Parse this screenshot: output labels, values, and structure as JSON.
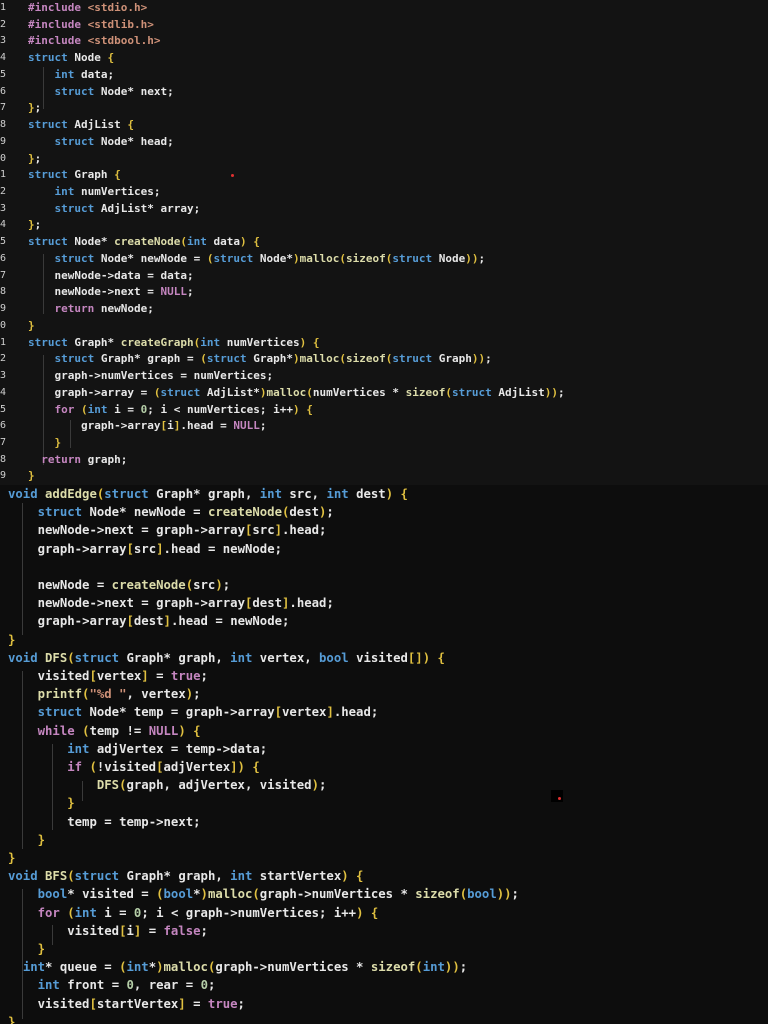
{
  "colors": {
    "keyword": "#569cd6",
    "control": "#c586c0",
    "function": "#dcdcaa",
    "text": "#e8e8e8",
    "punctuation": "#e0c040",
    "string": "#ce9178",
    "number": "#b5cea8"
  },
  "top_panel": {
    "line_numbers": [
      "1",
      "2",
      "3",
      "4",
      "5",
      "6",
      "7",
      "8",
      "9",
      "0",
      "1",
      "2",
      "3",
      "4",
      "5",
      "6",
      "7",
      "8",
      "9",
      "0",
      "1",
      "2",
      "3",
      "4",
      "5",
      "6",
      "7",
      "8",
      "9"
    ],
    "lines": [
      "#include <stdio.h>",
      "#include <stdlib.h>",
      "#include <stdbool.h>",
      "struct Node {",
      "    int data;",
      "    struct Node* next;",
      "};",
      "struct AdjList {",
      "    struct Node* head;",
      "};",
      "struct Graph {",
      "    int numVertices;",
      "    struct AdjList* array;",
      "};",
      "struct Node* createNode(int data) {",
      "    struct Node* newNode = (struct Node*)malloc(sizeof(struct Node));",
      "    newNode->data = data;",
      "    newNode->next = NULL;",
      "    return newNode;",
      "}",
      "struct Graph* createGraph(int numVertices) {",
      "    struct Graph* graph = (struct Graph*)malloc(sizeof(struct Graph));",
      "    graph->numVertices = numVertices;",
      "    graph->array = (struct AdjList*)malloc(numVertices * sizeof(struct AdjList));",
      "    for (int i = 0; i < numVertices; i++) {",
      "        graph->array[i].head = NULL;",
      "    }",
      "  return graph;",
      "}"
    ]
  },
  "bottom_panel": {
    "lines": [
      "void addEdge(struct Graph* graph, int src, int dest) {",
      "    struct Node* newNode = createNode(dest);",
      "    newNode->next = graph->array[src].head;",
      "    graph->array[src].head = newNode;",
      "",
      "    newNode = createNode(src);",
      "    newNode->next = graph->array[dest].head;",
      "    graph->array[dest].head = newNode;",
      "}",
      "void DFS(struct Graph* graph, int vertex, bool visited[]) {",
      "    visited[vertex] = true;",
      "    printf(\"%d \", vertex);",
      "    struct Node* temp = graph->array[vertex].head;",
      "    while (temp != NULL) {",
      "        int adjVertex = temp->data;",
      "        if (!visited[adjVertex]) {",
      "            DFS(graph, adjVertex, visited);",
      "        }",
      "        temp = temp->next;",
      "    }",
      "}",
      "void BFS(struct Graph* graph, int startVertex) {",
      "    bool* visited = (bool*)malloc(graph->numVertices * sizeof(bool));",
      "    for (int i = 0; i < graph->numVertices; i++) {",
      "        visited[i] = false;",
      "    }",
      "  int* queue = (int*)malloc(graph->numVertices * sizeof(int));",
      "    int front = 0, rear = 0;",
      "    visited[startVertex] = true;",
      "}"
    ]
  }
}
